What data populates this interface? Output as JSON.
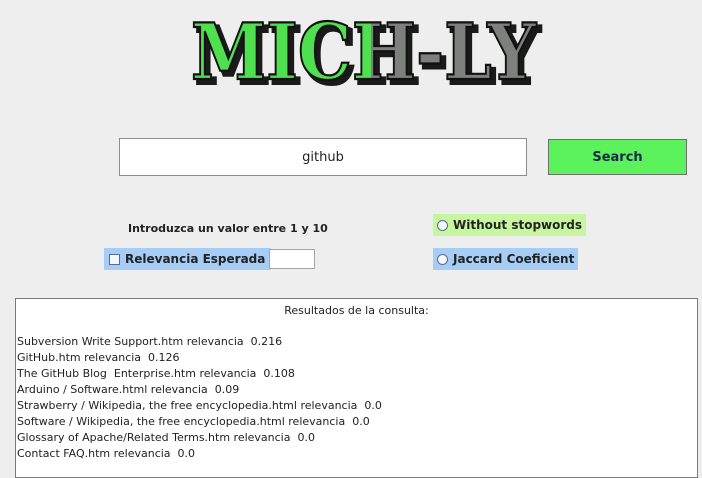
{
  "logo": {
    "text": "MICH-LY",
    "colors": {
      "green": "#4fe04f",
      "gray": "#7d807d",
      "dark": "#1a1a1a"
    }
  },
  "search": {
    "value": "github",
    "button_label": "Search"
  },
  "options": {
    "hint": "Introduzca un valor entre 1 y 10",
    "relevance_label": "Relevancia Esperada",
    "relevance_value": "",
    "stopwords_label": "Without stopwords",
    "jaccard_label": "Jaccard Coeficient"
  },
  "results": {
    "title": "Resultados de la consulta:",
    "items": [
      "Subversion Write Support.htm relevancia  0.216",
      "GitHub.htm relevancia  0.126",
      "The GitHub Blog  Enterprise.htm relevancia  0.108",
      "Arduino / Software.html relevancia  0.09",
      "Strawberry / Wikipedia, the free encyclopedia.html relevancia  0.0",
      "Software / Wikipedia, the free encyclopedia.html relevancia  0.0",
      "Glossary of Apache/Related Terms.htm relevancia  0.0",
      "Contact FAQ.htm relevancia  0.0"
    ]
  },
  "colors": {
    "background": "#eeeeee",
    "search_button": "#5bf25b",
    "blue_option": "#a6cdf5",
    "green_option": "#c6f7a0"
  }
}
